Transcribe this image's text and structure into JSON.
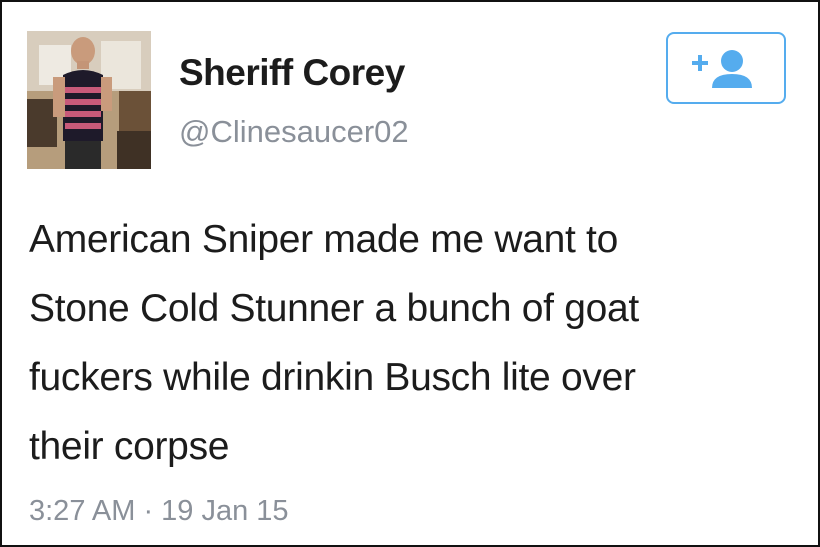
{
  "tweet": {
    "display_name": "Sheriff Corey",
    "handle": "@Clinesaucer02",
    "text_lines": [
      "American Sniper made me want to",
      "Stone Cold Stunner a bunch of goat",
      "fuckers while drinkin Busch lite over",
      "their corpse"
    ],
    "timestamp": "3:27 AM · 19 Jan 15"
  },
  "follow_button": {
    "icon": "add-user-icon"
  },
  "colors": {
    "accent": "#55acee",
    "text": "#1c1c1c",
    "muted": "#8a9099",
    "frame": "#111111"
  }
}
